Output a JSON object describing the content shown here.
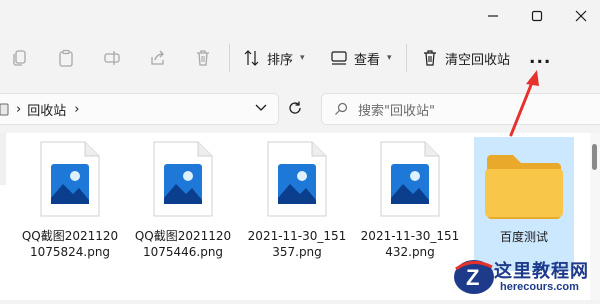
{
  "title_bar": {
    "buttons": [
      "minimize",
      "maximize",
      "close"
    ]
  },
  "toolbar": {
    "copy_icon": "copy-icon",
    "paste_icon": "paste-icon",
    "rename_icon": "rename-icon",
    "share_icon": "share-icon",
    "delete_icon": "trash-icon",
    "sort_label": "排序",
    "view_label": "查看",
    "empty_bin_label": "清空回收站",
    "more_label": "..."
  },
  "address": {
    "location": "回收站",
    "chevron_after": "›"
  },
  "search": {
    "placeholder": "搜索\"回收站\""
  },
  "items": [
    {
      "name": "QQ截图20211201075824.png",
      "type": "image"
    },
    {
      "name": "QQ截图20211201075446.png",
      "type": "image"
    },
    {
      "name": "2021-11-30_151357.png",
      "type": "image"
    },
    {
      "name": "2021-11-30_151432.png",
      "type": "image"
    },
    {
      "name": "百度测试",
      "type": "folder",
      "selected": true
    }
  ],
  "watermark": {
    "title": "这里教程网",
    "url": "herecours.com",
    "logo_letter": "Z"
  },
  "colors": {
    "accent": "#0067c0",
    "selection": "#cce8ff",
    "folder": "#f8c74a",
    "arrow": "#e5322d",
    "watermark": "#1e3a8a"
  }
}
